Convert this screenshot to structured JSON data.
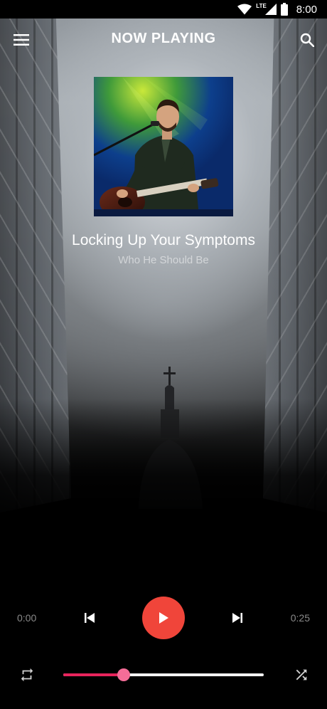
{
  "status_bar": {
    "time": "8:00",
    "network_label": "LTE",
    "icons": [
      "wifi-icon",
      "cell-signal-icon",
      "battery-icon"
    ]
  },
  "toolbar": {
    "title": "NOW PLAYING",
    "icons": [
      "menu-icon",
      "search-icon"
    ]
  },
  "track": {
    "title": "Locking Up Your Symptoms",
    "artist": "Who He Should Be"
  },
  "player": {
    "elapsed": "0:00",
    "duration": "0:25",
    "progress_fraction": 0.3,
    "icons": [
      "skip-previous-icon",
      "play-icon",
      "skip-next-icon",
      "repeat-icon",
      "shuffle-icon"
    ]
  },
  "colors": {
    "accent": "#f0453a",
    "progress": "#e8245c",
    "thumb": "#f56d98",
    "track": "#f2f2f2",
    "secondary_text": "#8a8a8a"
  }
}
